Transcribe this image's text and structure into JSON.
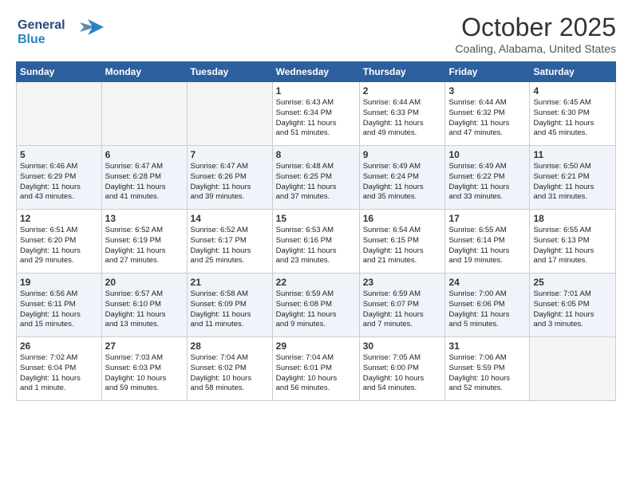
{
  "header": {
    "logo_line1": "General",
    "logo_line2": "Blue",
    "month": "October 2025",
    "location": "Coaling, Alabama, United States"
  },
  "days_of_week": [
    "Sunday",
    "Monday",
    "Tuesday",
    "Wednesday",
    "Thursday",
    "Friday",
    "Saturday"
  ],
  "weeks": [
    [
      {
        "day": "",
        "data": ""
      },
      {
        "day": "",
        "data": ""
      },
      {
        "day": "",
        "data": ""
      },
      {
        "day": "1",
        "data": "Sunrise: 6:43 AM\nSunset: 6:34 PM\nDaylight: 11 hours\nand 51 minutes."
      },
      {
        "day": "2",
        "data": "Sunrise: 6:44 AM\nSunset: 6:33 PM\nDaylight: 11 hours\nand 49 minutes."
      },
      {
        "day": "3",
        "data": "Sunrise: 6:44 AM\nSunset: 6:32 PM\nDaylight: 11 hours\nand 47 minutes."
      },
      {
        "day": "4",
        "data": "Sunrise: 6:45 AM\nSunset: 6:30 PM\nDaylight: 11 hours\nand 45 minutes."
      }
    ],
    [
      {
        "day": "5",
        "data": "Sunrise: 6:46 AM\nSunset: 6:29 PM\nDaylight: 11 hours\nand 43 minutes."
      },
      {
        "day": "6",
        "data": "Sunrise: 6:47 AM\nSunset: 6:28 PM\nDaylight: 11 hours\nand 41 minutes."
      },
      {
        "day": "7",
        "data": "Sunrise: 6:47 AM\nSunset: 6:26 PM\nDaylight: 11 hours\nand 39 minutes."
      },
      {
        "day": "8",
        "data": "Sunrise: 6:48 AM\nSunset: 6:25 PM\nDaylight: 11 hours\nand 37 minutes."
      },
      {
        "day": "9",
        "data": "Sunrise: 6:49 AM\nSunset: 6:24 PM\nDaylight: 11 hours\nand 35 minutes."
      },
      {
        "day": "10",
        "data": "Sunrise: 6:49 AM\nSunset: 6:22 PM\nDaylight: 11 hours\nand 33 minutes."
      },
      {
        "day": "11",
        "data": "Sunrise: 6:50 AM\nSunset: 6:21 PM\nDaylight: 11 hours\nand 31 minutes."
      }
    ],
    [
      {
        "day": "12",
        "data": "Sunrise: 6:51 AM\nSunset: 6:20 PM\nDaylight: 11 hours\nand 29 minutes."
      },
      {
        "day": "13",
        "data": "Sunrise: 6:52 AM\nSunset: 6:19 PM\nDaylight: 11 hours\nand 27 minutes."
      },
      {
        "day": "14",
        "data": "Sunrise: 6:52 AM\nSunset: 6:17 PM\nDaylight: 11 hours\nand 25 minutes."
      },
      {
        "day": "15",
        "data": "Sunrise: 6:53 AM\nSunset: 6:16 PM\nDaylight: 11 hours\nand 23 minutes."
      },
      {
        "day": "16",
        "data": "Sunrise: 6:54 AM\nSunset: 6:15 PM\nDaylight: 11 hours\nand 21 minutes."
      },
      {
        "day": "17",
        "data": "Sunrise: 6:55 AM\nSunset: 6:14 PM\nDaylight: 11 hours\nand 19 minutes."
      },
      {
        "day": "18",
        "data": "Sunrise: 6:55 AM\nSunset: 6:13 PM\nDaylight: 11 hours\nand 17 minutes."
      }
    ],
    [
      {
        "day": "19",
        "data": "Sunrise: 6:56 AM\nSunset: 6:11 PM\nDaylight: 11 hours\nand 15 minutes."
      },
      {
        "day": "20",
        "data": "Sunrise: 6:57 AM\nSunset: 6:10 PM\nDaylight: 11 hours\nand 13 minutes."
      },
      {
        "day": "21",
        "data": "Sunrise: 6:58 AM\nSunset: 6:09 PM\nDaylight: 11 hours\nand 11 minutes."
      },
      {
        "day": "22",
        "data": "Sunrise: 6:59 AM\nSunset: 6:08 PM\nDaylight: 11 hours\nand 9 minutes."
      },
      {
        "day": "23",
        "data": "Sunrise: 6:59 AM\nSunset: 6:07 PM\nDaylight: 11 hours\nand 7 minutes."
      },
      {
        "day": "24",
        "data": "Sunrise: 7:00 AM\nSunset: 6:06 PM\nDaylight: 11 hours\nand 5 minutes."
      },
      {
        "day": "25",
        "data": "Sunrise: 7:01 AM\nSunset: 6:05 PM\nDaylight: 11 hours\nand 3 minutes."
      }
    ],
    [
      {
        "day": "26",
        "data": "Sunrise: 7:02 AM\nSunset: 6:04 PM\nDaylight: 11 hours\nand 1 minute."
      },
      {
        "day": "27",
        "data": "Sunrise: 7:03 AM\nSunset: 6:03 PM\nDaylight: 10 hours\nand 59 minutes."
      },
      {
        "day": "28",
        "data": "Sunrise: 7:04 AM\nSunset: 6:02 PM\nDaylight: 10 hours\nand 58 minutes."
      },
      {
        "day": "29",
        "data": "Sunrise: 7:04 AM\nSunset: 6:01 PM\nDaylight: 10 hours\nand 56 minutes."
      },
      {
        "day": "30",
        "data": "Sunrise: 7:05 AM\nSunset: 6:00 PM\nDaylight: 10 hours\nand 54 minutes."
      },
      {
        "day": "31",
        "data": "Sunrise: 7:06 AM\nSunset: 5:59 PM\nDaylight: 10 hours\nand 52 minutes."
      },
      {
        "day": "",
        "data": ""
      }
    ]
  ]
}
